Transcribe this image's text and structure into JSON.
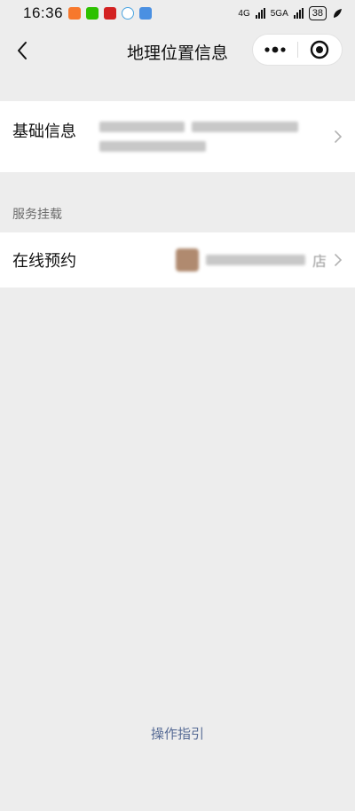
{
  "status_bar": {
    "time": "16:36",
    "network_1": "4G",
    "network_2": "5GA",
    "battery": "38"
  },
  "navbar": {
    "title": "地理位置信息",
    "back_icon": "chevron-left-icon",
    "more_icon": "more-dots-icon",
    "close_icon": "target-circle-icon"
  },
  "basic_info": {
    "label": "基础信息"
  },
  "services": {
    "section_label": "服务挂载",
    "online_booking_label": "在线预约",
    "online_booking_suffix": "店"
  },
  "footer": {
    "guide_link": "操作指引"
  },
  "colors": {
    "page_bg": "#ededed",
    "cell_bg": "#ffffff",
    "link": "#576b95"
  }
}
